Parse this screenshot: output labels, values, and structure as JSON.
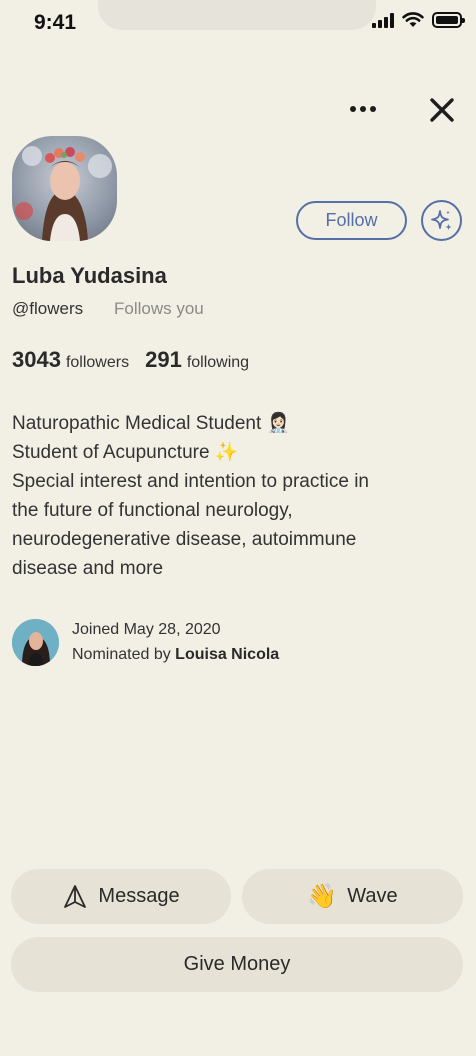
{
  "status_bar": {
    "time": "9:41"
  },
  "profile": {
    "name": "Luba Yudasina",
    "handle": "@flowers",
    "follows_you": "Follows you",
    "followers_count": "3043",
    "followers_label": "followers",
    "following_count": "291",
    "following_label": "following",
    "follow_button": "Follow"
  },
  "bio": [
    "Naturopathic Medical Student 👩🏻‍⚕️",
    "Student of Acupuncture ✨",
    "Special interest and intention to practice in",
    "the future of functional neurology,",
    "neurodegenerative disease, autoimmune",
    "disease and more"
  ],
  "joined": {
    "date_text": "Joined May 28, 2020",
    "nominated_prefix": "Nominated by ",
    "nominated_by": "Louisa Nicola"
  },
  "actions": {
    "message": "Message",
    "wave": "Wave",
    "wave_emoji": "👋",
    "give_money": "Give Money"
  },
  "colors": {
    "background": "#F2EFE5",
    "accent": "#5470A7",
    "button_bg": "#E6E2D5"
  }
}
